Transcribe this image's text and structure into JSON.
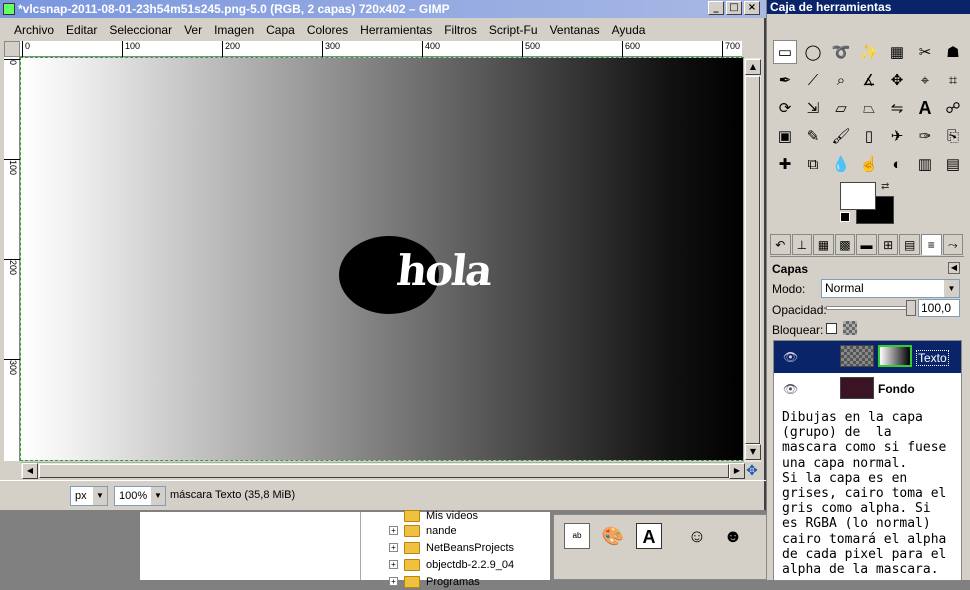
{
  "window": {
    "title": "*vlcsnap-2011-08-01-23h54m51s245.png-5.0 (RGB, 2 capas) 720x402 – GIMP"
  },
  "menu": [
    "Archivo",
    "Editar",
    "Seleccionar",
    "Ver",
    "Imagen",
    "Capa",
    "Colores",
    "Herramientas",
    "Filtros",
    "Script-Fu",
    "Ventanas",
    "Ayuda"
  ],
  "ruler": {
    "h_ticks": [
      "0",
      "100",
      "200",
      "300",
      "400",
      "500",
      "600",
      "700"
    ],
    "v_ticks": [
      "0",
      "100",
      "200",
      "300"
    ]
  },
  "canvas": {
    "text": "hola"
  },
  "status": {
    "unit": "px",
    "zoom": "100%",
    "info": "máscara Texto (35,8 MiB)"
  },
  "toolbox": {
    "title": "Caja de herramientas"
  },
  "layers": {
    "title": "Capas",
    "mode_label": "Modo:",
    "mode_value": "Normal",
    "opacity_label": "Opacidad:",
    "opacity_value": "100,0",
    "lock_label": "Bloquear:",
    "items": [
      {
        "name": "Texto",
        "selected": true
      },
      {
        "name": "Fondo",
        "selected": false
      }
    ],
    "note": "Dibujas en la capa\n(grupo) de  la\nmascara como si fuese\nuna capa normal.\nSi la capa es en\ngrises, cairo toma el\ngris como alpha. Si\nes RGBA (lo normal)\ncairo tomará el alpha\nde cada pixel para el\nalpha de la mascara."
  },
  "file_tree": [
    "Mis videos",
    "nande",
    "NetBeansProjects",
    "objectdb-2.2.9_04",
    "Programas"
  ],
  "colors": {
    "foreground": "#ffffff",
    "background": "#000000",
    "selection": "#0a246a"
  }
}
